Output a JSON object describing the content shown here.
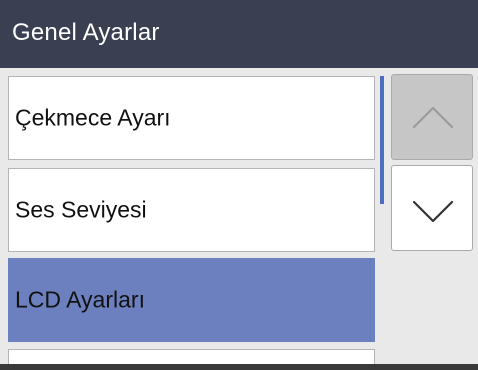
{
  "header": {
    "title": "Genel Ayarlar"
  },
  "menu": {
    "items": [
      {
        "label": "Çekmece Ayarı",
        "selected": false
      },
      {
        "label": "Ses Seviyesi",
        "selected": false
      },
      {
        "label": "LCD Ayarları",
        "selected": true
      },
      {
        "label": "",
        "selected": false
      }
    ]
  },
  "scroll": {
    "up_icon": "chevron-up-icon",
    "down_icon": "chevron-down-icon"
  },
  "colors": {
    "header_bg": "#3b3f52",
    "selected_bg": "#6c80bf",
    "scrollbar": "#4d6fc0",
    "background": "#e9e9e9"
  }
}
